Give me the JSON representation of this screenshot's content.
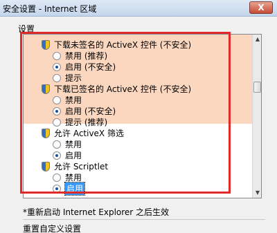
{
  "window": {
    "title": "安全设置 - Internet 区域",
    "close_label": "X"
  },
  "settings_label": "设置",
  "list": {
    "groups": [
      {
        "title": "下载未签名的 ActiveX 控件 (不安全)",
        "highlighted": true,
        "options": [
          {
            "label": "禁用 (推荐)",
            "checked": false
          },
          {
            "label": "启用 (不安全)",
            "checked": true
          },
          {
            "label": "提示",
            "checked": false
          }
        ]
      },
      {
        "title": "下载已签名的 ActiveX 控件 (不安全)",
        "highlighted": true,
        "options": [
          {
            "label": "禁用",
            "checked": false
          },
          {
            "label": "启用 (不安全)",
            "checked": true
          },
          {
            "label": "提示 (推荐)",
            "checked": false
          }
        ]
      },
      {
        "title": "允许 ActiveX 筛选",
        "highlighted": false,
        "options": [
          {
            "label": "禁用",
            "checked": false
          },
          {
            "label": "启用",
            "checked": true
          }
        ]
      },
      {
        "title": "允许 Scriptlet",
        "highlighted": false,
        "options": [
          {
            "label": "禁用",
            "checked": false
          },
          {
            "label": "启用",
            "checked": true,
            "selected": true
          }
        ]
      }
    ]
  },
  "note": "*重新启动 Internet Explorer 之后生效",
  "reset_label": "重置自定义设置",
  "colors": {
    "highlight_band": "#fbd7c0",
    "annotation_box": "#e02a2a",
    "selection": "#3399ff"
  }
}
